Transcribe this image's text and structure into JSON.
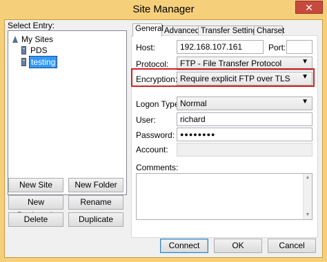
{
  "window": {
    "title": "Site Manager",
    "close_glyph": "✕"
  },
  "left": {
    "select_entry_label": "Select Entry:",
    "tree": {
      "root": "My Sites",
      "items": [
        "PDS",
        "testing"
      ],
      "selected": "testing"
    },
    "buttons": {
      "new_site": "New Site",
      "new_folder": "New Folder",
      "new_bookmark": "New Bookmark",
      "rename": "Rename",
      "delete": "Delete",
      "duplicate": "Duplicate"
    }
  },
  "tabs": [
    "General",
    "Advanced",
    "Transfer Settings",
    "Charset"
  ],
  "general": {
    "host_label": "Host:",
    "host_value": "192.168.107.161",
    "port_label": "Port:",
    "port_value": "",
    "protocol_label": "Protocol:",
    "protocol_value": "FTP - File Transfer Protocol",
    "encryption_label": "Encryption:",
    "encryption_value": "Require explicit FTP over TLS",
    "logon_label": "Logon Type:",
    "logon_value": "Normal",
    "user_label": "User:",
    "user_value": "richard",
    "password_label": "Password:",
    "password_value": "●●●●●●●●",
    "account_label": "Account:",
    "account_value": "",
    "comments_label": "Comments:"
  },
  "bottom": {
    "connect": "Connect",
    "ok": "OK",
    "cancel": "Cancel"
  },
  "colors": {
    "frame": "#f6cf7a",
    "highlight": "#d21f1f",
    "selection": "#3399ff",
    "close": "#c74a3f"
  }
}
